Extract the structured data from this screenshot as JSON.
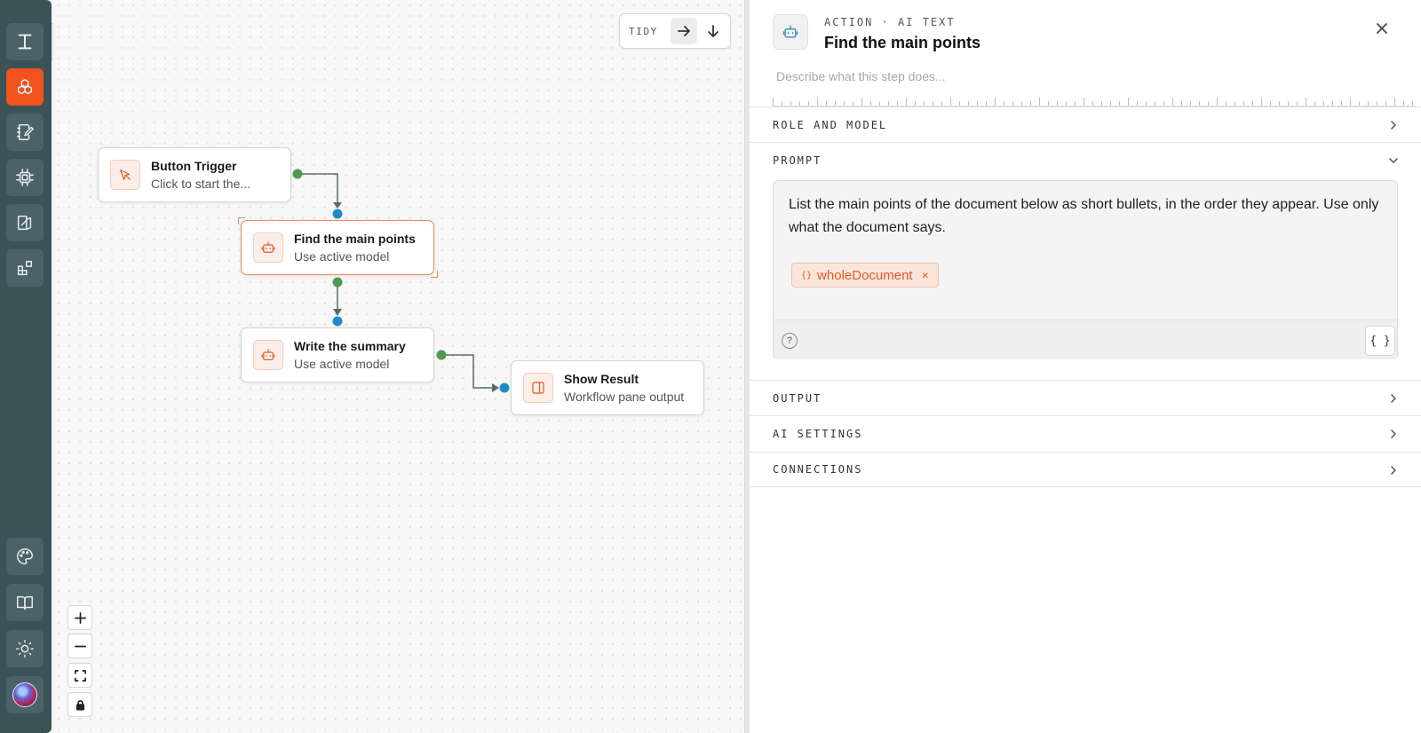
{
  "toolbar": {
    "tidy_label": "TIDY"
  },
  "nodes": [
    {
      "title": "Button Trigger",
      "subtitle": "Click to start the..."
    },
    {
      "title": "Find the main points",
      "subtitle": "Use active model"
    },
    {
      "title": "Write the summary",
      "subtitle": "Use active model"
    },
    {
      "title": "Show Result",
      "subtitle": "Workflow pane output"
    }
  ],
  "panel": {
    "kicker": "ACTION · AI TEXT",
    "title": "Find the main points",
    "description_placeholder": "Describe what this step does...",
    "sections": {
      "role_model": "ROLE AND MODEL",
      "prompt": "PROMPT",
      "output": "OUTPUT",
      "ai_settings": "AI SETTINGS",
      "connections": "CONNECTIONS"
    },
    "prompt_text": "List the main points of the document below as short bullets, in the order they appear. Use only what the document says.",
    "variable_chip": "wholeDocument",
    "chip_brace": "{}",
    "chip_remove": "×",
    "help_glyph": "?",
    "insert_variable_label": "{ }"
  },
  "colors": {
    "accent": "#f0531c",
    "rail": "#3b5257",
    "port_out": "#4e9a51",
    "port_in": "#1f8ac9"
  }
}
